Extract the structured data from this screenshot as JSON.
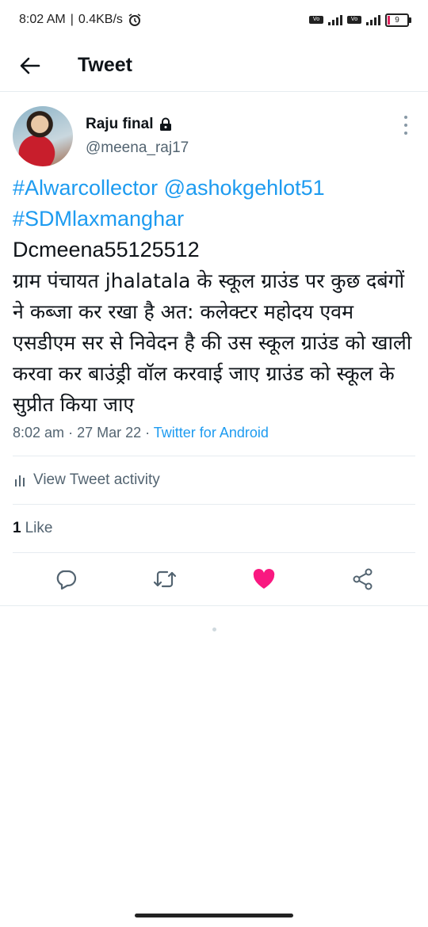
{
  "status": {
    "time": "8:02 AM",
    "speed": "0.4KB/s",
    "battery": "9"
  },
  "header": {
    "title": "Tweet"
  },
  "tweet": {
    "author_name": "Raju final",
    "handle": "@meena_raj17",
    "line1_link1": "#Alwarcollector",
    "line1_link2": "@ashokgehlot51",
    "line2_link": "#SDMlaxmanghar",
    "line3": "Dcmeena55125512",
    "body_hindi": "ग्राम पंचायत jhalatala के स्कूल ग्राउंड पर कुछ दबंगों ने कब्जा कर रखा है अत: कलेक्टर महोदय एवम एसडीएम सर से निवेदन है की उस स्कूल ग्राउंड को खाली करवा कर बाउंड्री वॉल करवाई जाए ग्राउंड  को स्कूल के सुप्रीत किया जाए",
    "time": "8:02 am",
    "date": "27 Mar 22",
    "source": "Twitter for Android"
  },
  "activity": {
    "label": "View Tweet activity"
  },
  "likes": {
    "count": "1",
    "label": "Like"
  },
  "colors": {
    "accent": "#1d9bf0",
    "like": "#f91880"
  },
  "icons": [
    "back-arrow-icon",
    "lock-icon",
    "more-vertical-icon",
    "activity-bars-icon",
    "reply-icon",
    "retweet-icon",
    "heart-icon",
    "share-icon"
  ]
}
